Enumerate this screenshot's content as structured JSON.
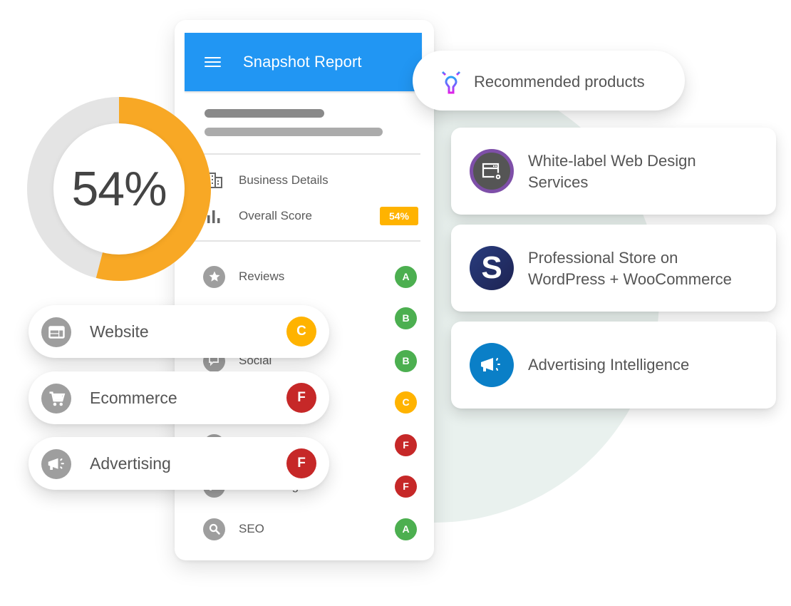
{
  "report": {
    "title": "Snapshot Report",
    "business_details_label": "Business Details",
    "overall_score_label": "Overall Score",
    "overall_score_value": "54%",
    "sections": [
      {
        "label": "Reviews",
        "grade": "A",
        "icon": "star-icon"
      },
      {
        "label": "",
        "grade": "B",
        "icon": "website-icon"
      },
      {
        "label": "Social",
        "grade": "B",
        "icon": "chat-icon"
      },
      {
        "label": "",
        "grade": "C",
        "icon": "cart-icon"
      },
      {
        "label": "",
        "grade": "F",
        "icon": "listing-icon"
      },
      {
        "label": "Advertising",
        "grade": "F",
        "icon": "megaphone-icon"
      },
      {
        "label": "SEO",
        "grade": "A",
        "icon": "search-icon"
      }
    ]
  },
  "donut": {
    "value_label": "54%",
    "fraction": 0.54,
    "fill_color": "#f8a825",
    "track_color": "#e4e4e4"
  },
  "pills": [
    {
      "label": "Website",
      "grade": "C",
      "icon": "website-icon"
    },
    {
      "label": "Ecommerce",
      "grade": "F",
      "icon": "cart-icon"
    },
    {
      "label": "Advertising",
      "grade": "F",
      "icon": "megaphone-icon"
    }
  ],
  "recommended": {
    "title": "Recommended products",
    "icon": "lightbulb-icon",
    "products": [
      {
        "line1": "White-label Web Design",
        "line2": "Services",
        "icon": "web-design-icon"
      },
      {
        "line1": "Professional Store on",
        "line2": "WordPress + WooCommerce",
        "icon": "store-s-icon"
      },
      {
        "line1": "Advertising Intelligence",
        "line2": "",
        "icon": "megaphone-icon"
      }
    ]
  },
  "colors": {
    "header_blue": "#2196f3",
    "grade_A": "#4caf50",
    "grade_B": "#4caf50",
    "grade_C": "#ffb300",
    "grade_F": "#c62828",
    "score_badge": "#ffb300"
  }
}
